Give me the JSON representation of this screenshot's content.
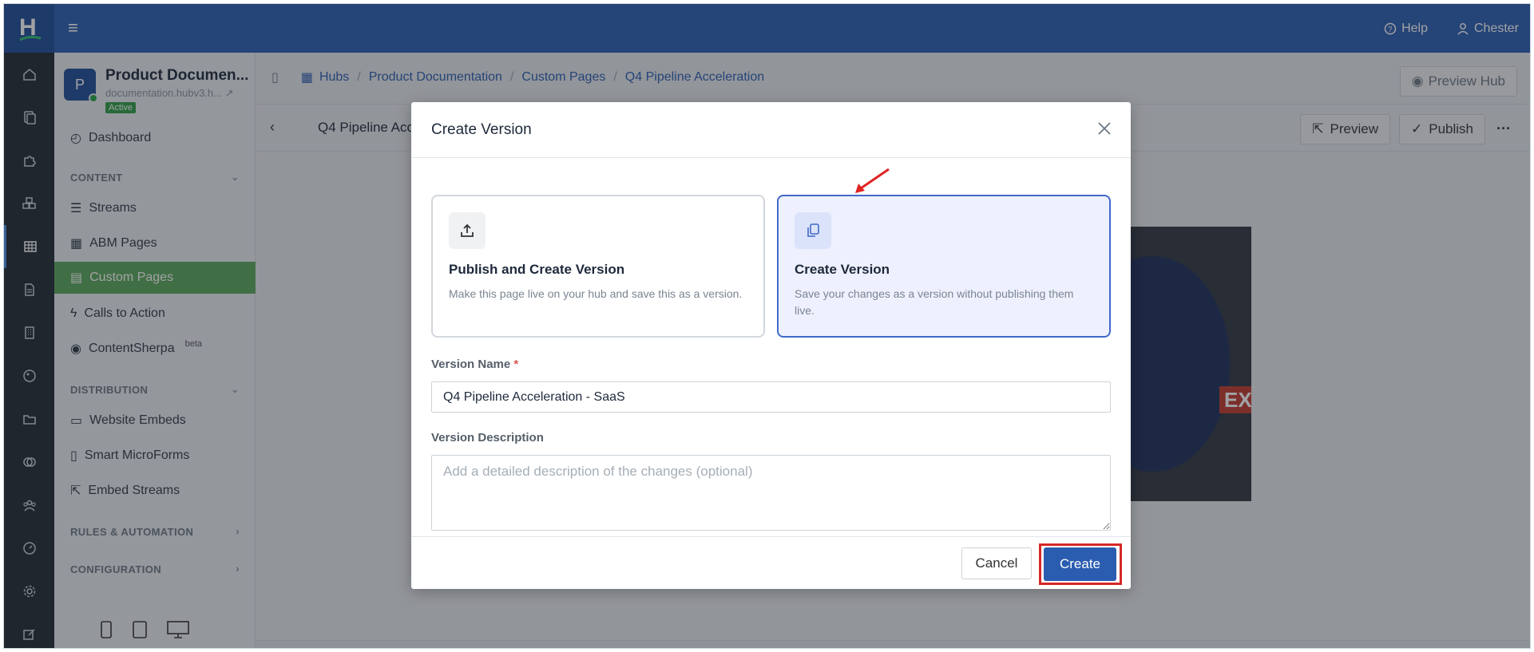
{
  "topbar": {
    "logo": "H",
    "help": "Help",
    "user": "Chester"
  },
  "hub": {
    "initial": "P",
    "title": "Product Documen...",
    "url": "documentation.hubv3.h...",
    "status": "Active"
  },
  "sidebar": {
    "dashboard": "Dashboard",
    "content_section": "CONTENT",
    "items": [
      "Streams",
      "ABM Pages",
      "Custom Pages",
      "Calls to Action",
      "ContentSherpa"
    ],
    "beta": "beta",
    "distribution_section": "DISTRIBUTION",
    "distribution_items": [
      "Website Embeds",
      "Smart MicroForms",
      "Embed Streams"
    ],
    "rules_section": "RULES & AUTOMATION",
    "config_section": "CONFIGURATION"
  },
  "breadcrumb": {
    "hubs": "Hubs",
    "product_doc": "Product Documentation",
    "custom_pages": "Custom Pages",
    "current": "Q4 Pipeline Acceleration"
  },
  "page_header": {
    "title": "Q4 Pipeline Acc",
    "preview_hub": "Preview Hub",
    "preview": "Preview",
    "publish": "Publish"
  },
  "canvas": {
    "image_text": "EX"
  },
  "modal": {
    "title": "Create Version",
    "option_publish": {
      "title": "Publish and Create Version",
      "desc": "Make this page live on your hub and save this as a version."
    },
    "option_create": {
      "title": "Create Version",
      "desc": "Save your changes as a version without publishing them live."
    },
    "version_name_label": "Version Name",
    "required_mark": "*",
    "version_name_value": "Q4 Pipeline Acceleration - SaaS",
    "version_desc_label": "Version Description",
    "version_desc_placeholder": "Add a detailed description of the changes (optional)",
    "cancel": "Cancel",
    "create": "Create"
  },
  "colors": {
    "brand_blue": "#2a5db0",
    "active_green": "#5aa75a",
    "annotation_red": "#d62828",
    "selected_border": "#4169c9"
  }
}
